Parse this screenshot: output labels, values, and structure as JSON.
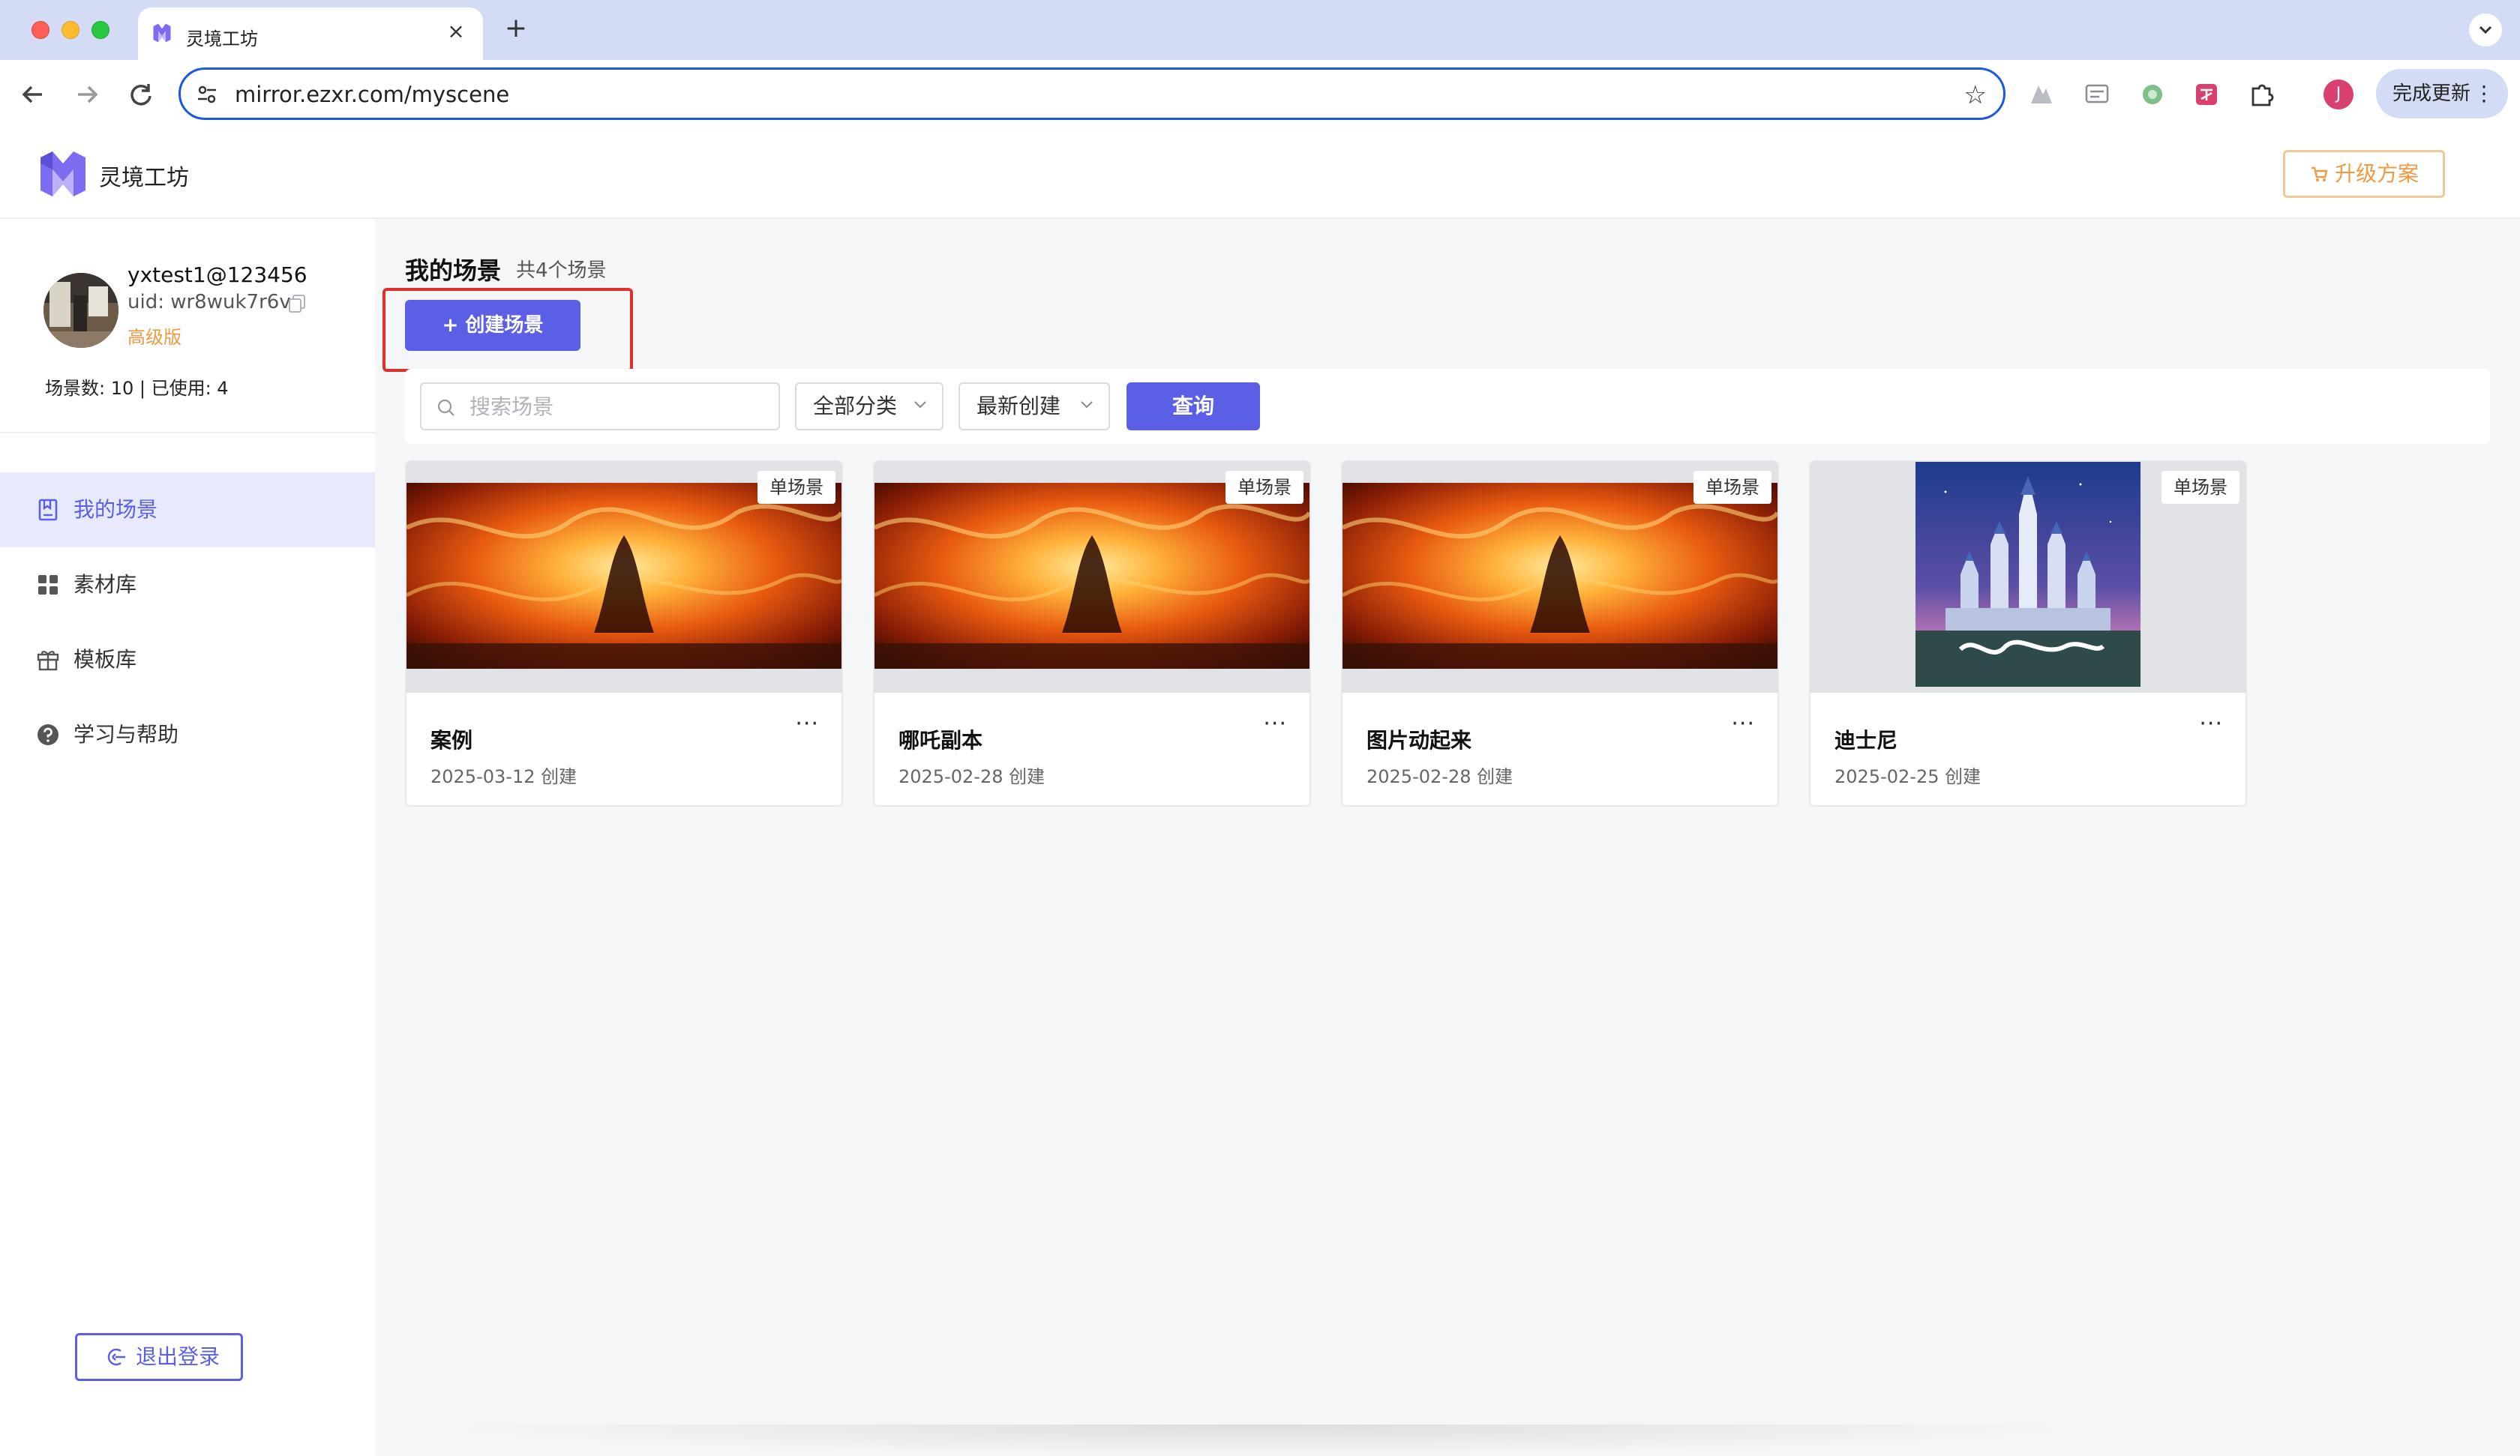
{
  "browser": {
    "tab_title": "灵境工坊",
    "new_tab": "+",
    "close": "×",
    "url": "mirror.ezxr.com/myscene",
    "update_label": "完成更新",
    "profile_initial": "J"
  },
  "header": {
    "brand": "灵境工坊",
    "upgrade_label": "升级方案"
  },
  "user": {
    "name": "yxtest1@123456",
    "uid": "uid: wr8wuk7r6v",
    "tier": "高级版",
    "quota": "场景数: 10 | 已使用:  4"
  },
  "sidebar": {
    "items": [
      {
        "label": "我的场景",
        "icon": "bookmark-icon",
        "active": true
      },
      {
        "label": "素材库",
        "icon": "grid-icon",
        "active": false
      },
      {
        "label": "模板库",
        "icon": "gift-icon",
        "active": false
      },
      {
        "label": "学习与帮助",
        "icon": "help-icon",
        "active": false
      }
    ],
    "logout_label": "退出登录"
  },
  "main": {
    "title": "我的场景",
    "count": "共4个场景",
    "create_label": "+ 创建场景",
    "search_placeholder": "搜索场景",
    "category_select": "全部分类",
    "sort_select": "最新创建",
    "query_label": "查询",
    "cards": [
      {
        "badge": "单场景",
        "title": "案例",
        "date": "2025-03-12 创建",
        "thumbnail": "fire-artwork"
      },
      {
        "badge": "单场景",
        "title": "哪吒副本",
        "date": "2025-02-28 创建",
        "thumbnail": "fire-artwork"
      },
      {
        "badge": "单场景",
        "title": "图片动起来",
        "date": "2025-02-28 创建",
        "thumbnail": "fire-artwork"
      },
      {
        "badge": "单场景",
        "title": "迪士尼",
        "date": "2025-02-25 创建",
        "thumbnail": "castle-photo"
      }
    ],
    "more_label": "···"
  },
  "colors": {
    "accent": "#5a5fe6",
    "accent_light": "#e8e9fb",
    "upgrade": "#ef9a43",
    "highlight": "#e0302a",
    "omnibox_border": "#1a57e2"
  }
}
